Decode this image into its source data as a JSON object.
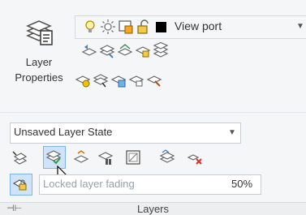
{
  "panel": {
    "big_button": {
      "line1": "Layer",
      "line2": "Properties",
      "icon": "layer-properties-icon"
    },
    "viewport_dropdown": {
      "value": "View port",
      "color": "#000000"
    },
    "state_dropdown": {
      "value": "Unsaved Layer State"
    },
    "fade": {
      "label": "Locked layer fading",
      "value": "50%"
    },
    "footer_title": "Layers",
    "footer_icon": "pin-icon"
  },
  "colors": {
    "accent_select": "#cfe4fa",
    "lightbulb": "#f2c200",
    "lock": "#e0a800",
    "green_check": "#2f9e44",
    "red_x": "#d93025"
  }
}
